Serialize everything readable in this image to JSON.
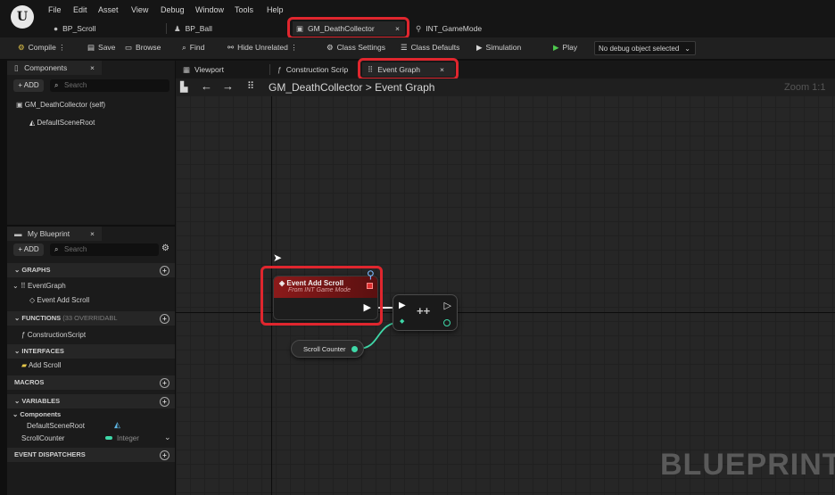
{
  "menu": [
    "File",
    "Edit",
    "Asset",
    "View",
    "Debug",
    "Window",
    "Tools",
    "Help"
  ],
  "doc_tabs": [
    "BP_Scroll",
    "BP_Ball",
    "GM_DeathCollector",
    "INT_GameMode"
  ],
  "toolbar": {
    "compile": "Compile",
    "save": "Save",
    "browse": "Browse",
    "find": "Find",
    "hide_unrelated": "Hide Unrelated",
    "class_settings": "Class Settings",
    "class_defaults": "Class Defaults",
    "simulation": "Simulation",
    "play": "Play",
    "debug_select": "No debug object selected"
  },
  "components": {
    "title": "Components",
    "add": "+ ADD",
    "search_placeholder": "Search",
    "self_item": "GM_DeathCollector (self)",
    "root_item": "DefaultSceneRoot"
  },
  "my_blueprint": {
    "title": "My Blueprint",
    "add": "+ ADD",
    "search_placeholder": "Search",
    "graphs_label": "GRAPHS",
    "event_graph": "EventGraph",
    "event_add_scroll": "Event Add Scroll",
    "functions_label": "FUNCTIONS",
    "functions_count": "(33 OVERRIDABL",
    "construction_script": "ConstructionScript",
    "interfaces_label": "INTERFACES",
    "add_scroll": "Add Scroll",
    "macros_label": "MACROS",
    "variables_label": "VARIABLES",
    "components_group": "Components",
    "var_root": "DefaultSceneRoot",
    "var_scroll_counter": "ScrollCounter",
    "var_type": "Integer",
    "dispatchers_label": "EVENT DISPATCHERS"
  },
  "graph_tabs": [
    "Viewport",
    "Construction Scrip",
    "Event Graph"
  ],
  "breadcrumb": {
    "blueprint": "GM_DeathCollector",
    "separator": ">",
    "graph": "Event Graph"
  },
  "zoom": "Zoom 1:1",
  "watermark": "BLUEPRINT",
  "event_node": {
    "title": "Event Add Scroll",
    "subtitle": "From INT Game Mode"
  },
  "increment_node": {
    "label": "++"
  },
  "var_node": {
    "label": "Scroll Counter"
  },
  "colors": {
    "highlight": "#e0262e",
    "event_header": "#8b1a1a",
    "integer_pin": "#3fd8a8",
    "play_green": "#4ec94e"
  }
}
